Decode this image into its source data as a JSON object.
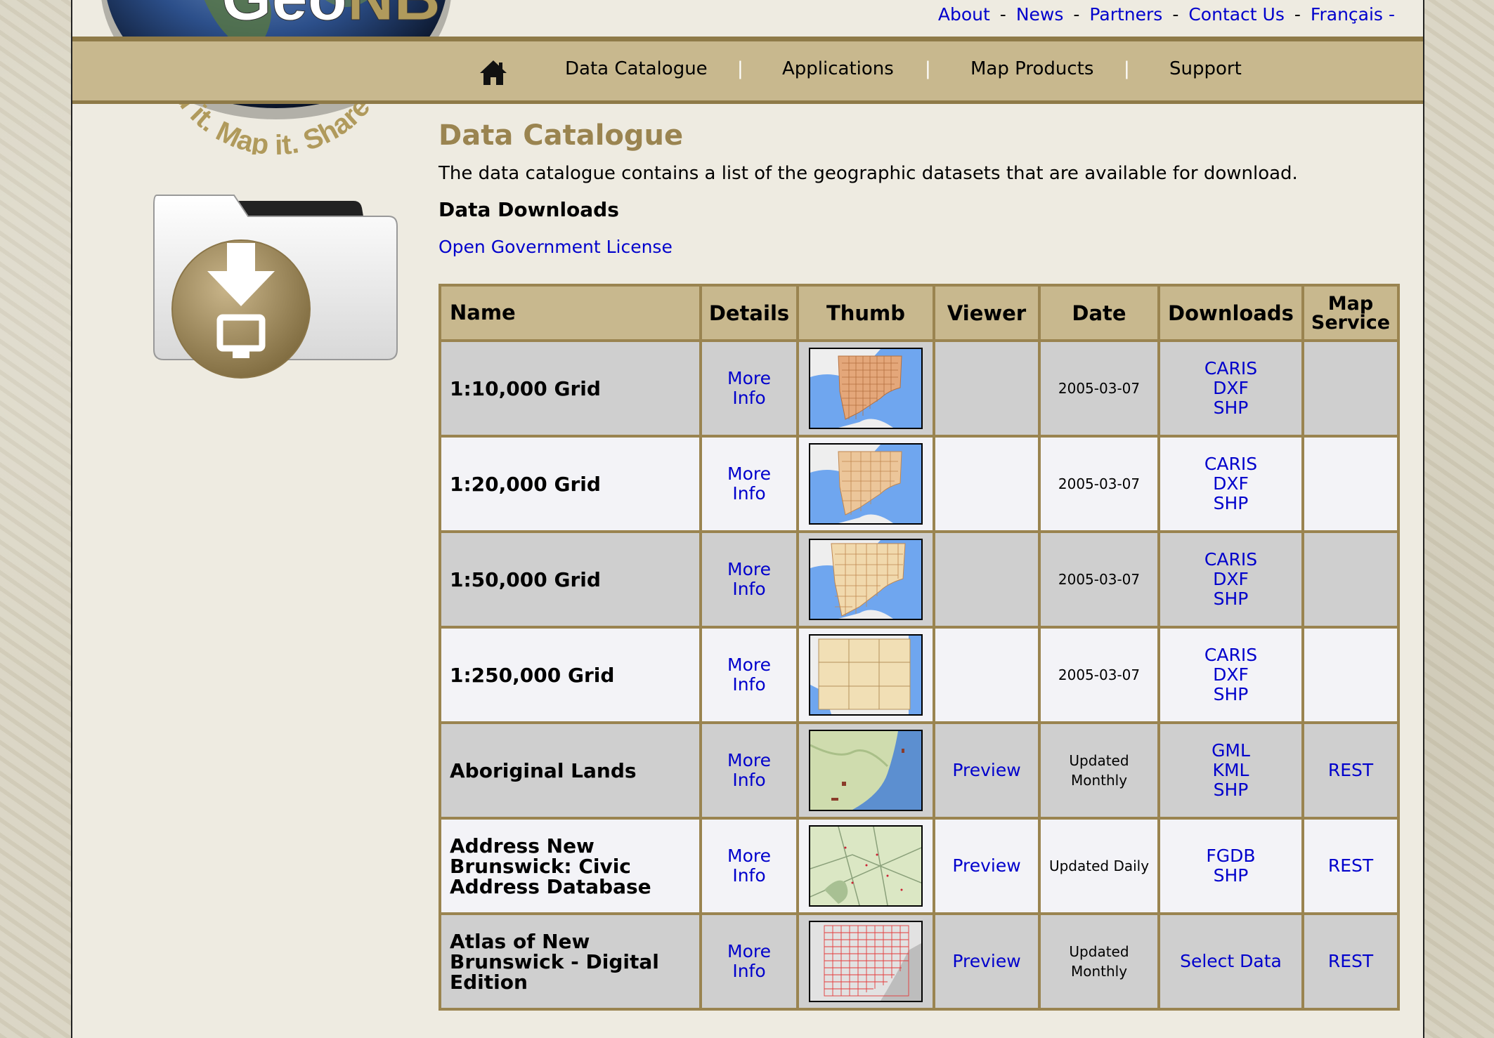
{
  "header": {
    "logo_text": "GeoNB",
    "tagline": "Find it. Map it. Share it.",
    "top_links": [
      "About",
      "News",
      "Partners",
      "Contact Us",
      "Français"
    ],
    "link_separator": "-"
  },
  "nav": {
    "items": [
      "Data Catalogue",
      "Applications",
      "Map Products",
      "Support"
    ],
    "separator": "|"
  },
  "main": {
    "title": "Data Catalogue",
    "intro": "The data catalogue contains a list of the geographic datasets that are available for download.",
    "subheading": "Data Downloads",
    "license_link": "Open Government License"
  },
  "table": {
    "headers": [
      "Name",
      "Details",
      "Thumb",
      "Viewer",
      "Date",
      "Downloads",
      "Map Service"
    ],
    "rows": [
      {
        "name": "1:10,000 Grid",
        "details": [
          "More",
          "Info"
        ],
        "viewer": "",
        "date": [
          "2005-03-07"
        ],
        "downloads": [
          "CARIS",
          "DXF",
          "SHP"
        ],
        "map_service": ""
      },
      {
        "name": "1:20,000 Grid",
        "details": [
          "More",
          "Info"
        ],
        "viewer": "",
        "date": [
          "2005-03-07"
        ],
        "downloads": [
          "CARIS",
          "DXF",
          "SHP"
        ],
        "map_service": ""
      },
      {
        "name": "1:50,000 Grid",
        "details": [
          "More",
          "Info"
        ],
        "viewer": "",
        "date": [
          "2005-03-07"
        ],
        "downloads": [
          "CARIS",
          "DXF",
          "SHP"
        ],
        "map_service": ""
      },
      {
        "name": "1:250,000 Grid",
        "details": [
          "More",
          "Info"
        ],
        "viewer": "",
        "date": [
          "2005-03-07"
        ],
        "downloads": [
          "CARIS",
          "DXF",
          "SHP"
        ],
        "map_service": ""
      },
      {
        "name": "Aboriginal Lands",
        "details": [
          "More",
          "Info"
        ],
        "viewer": "Preview",
        "date": [
          "Updated",
          "Monthly"
        ],
        "downloads": [
          "GML",
          "KML",
          "SHP"
        ],
        "map_service": "REST"
      },
      {
        "name": "Address New Brunswick: Civic Address Database",
        "details": [
          "More",
          "Info"
        ],
        "viewer": "Preview",
        "date": [
          "Updated Daily"
        ],
        "downloads": [
          "FGDB",
          "SHP"
        ],
        "map_service": "REST"
      },
      {
        "name": "Atlas of New Brunswick - Digital Edition",
        "details": [
          "More",
          "Info"
        ],
        "viewer": "Preview",
        "date": [
          "Updated",
          "Monthly"
        ],
        "downloads": [
          "Select Data"
        ],
        "map_service": "REST"
      }
    ]
  },
  "colors": {
    "accent": "#9a8450",
    "nav_bg": "#c8b88e",
    "link": "#0000cc",
    "page_bg": "#eeebe1",
    "row_odd": "#cfcfcf",
    "row_even": "#f3f3f7"
  },
  "icons": [
    "home-icon",
    "globe-logo",
    "download-folder-icon"
  ]
}
